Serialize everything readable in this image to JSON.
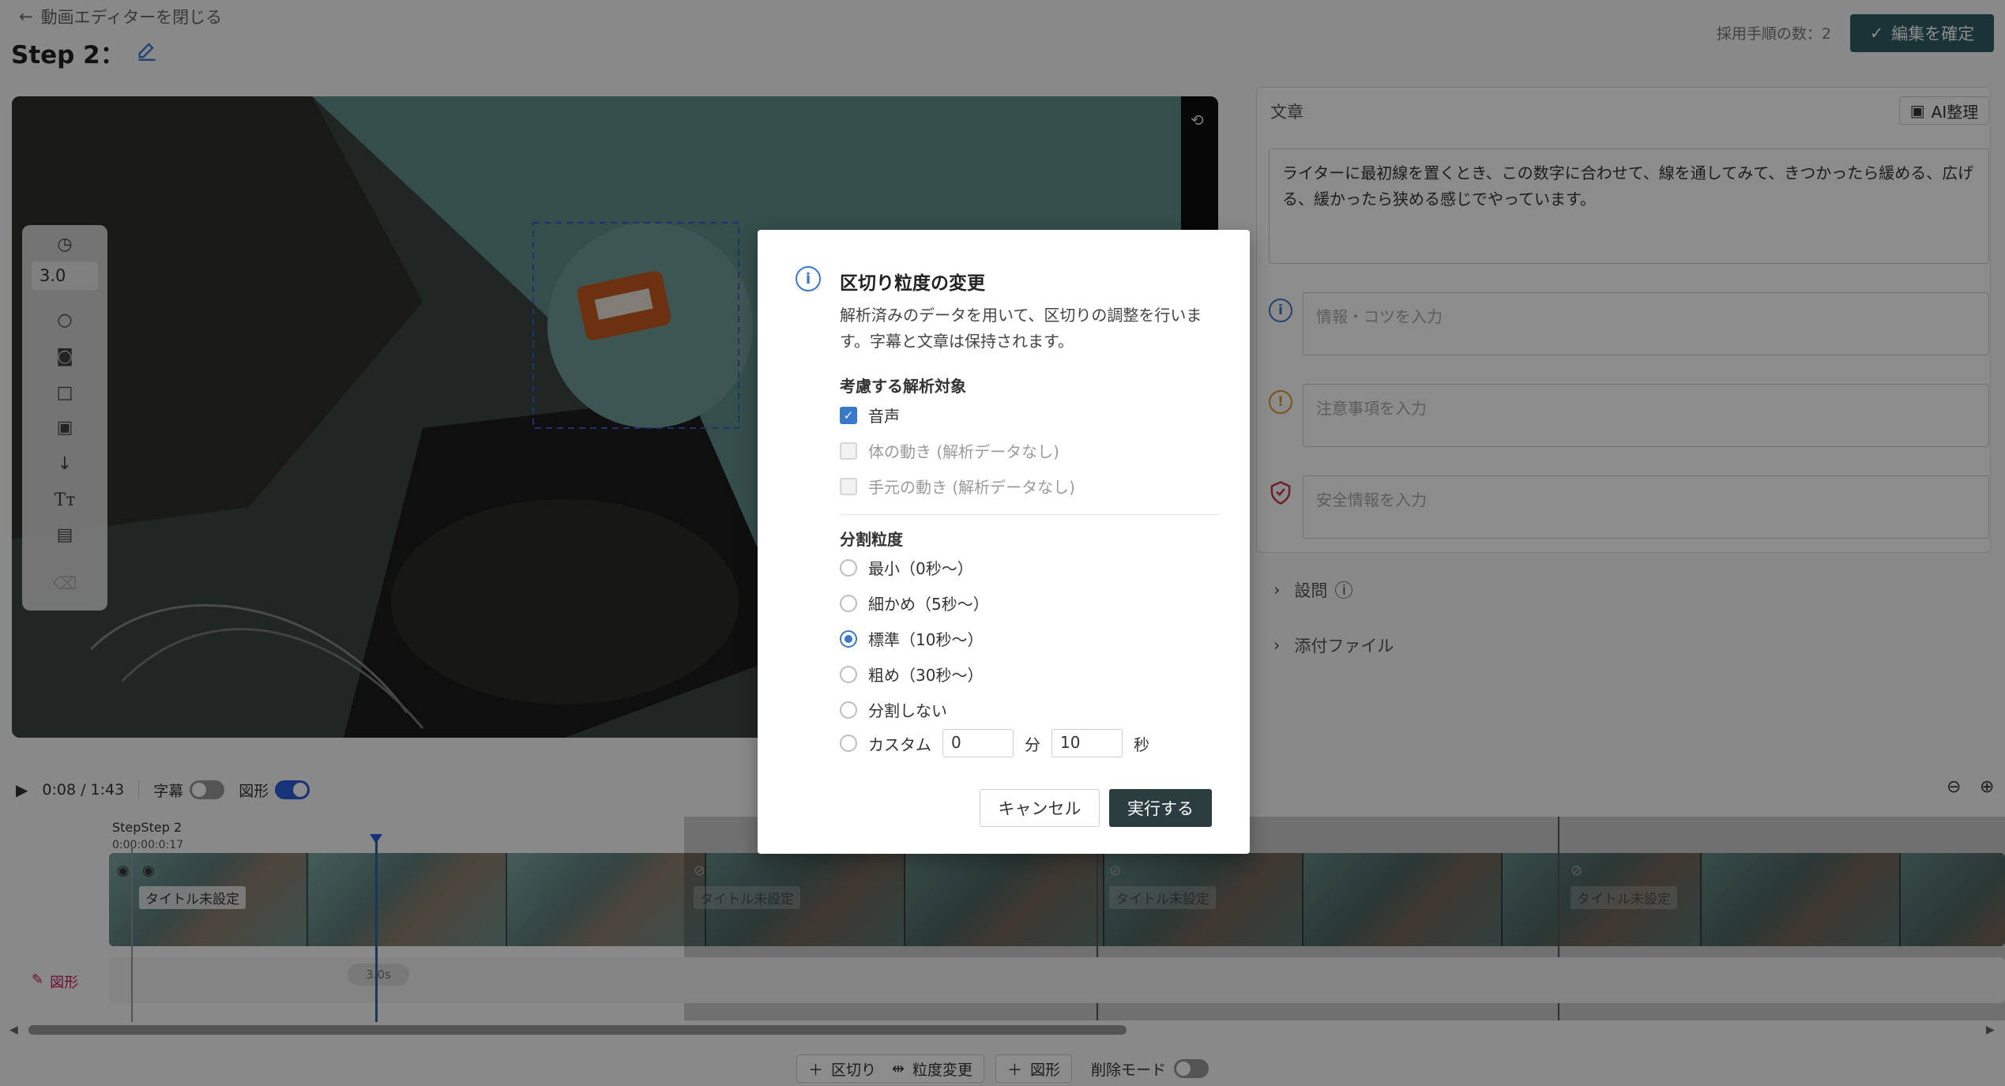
{
  "header": {
    "back_label": "動画エディターを閉じる",
    "step_title": "Step 2：",
    "step_count_label": "採用手順の数：2",
    "confirm_label": "編集を確定"
  },
  "video": {
    "duration_value": "3.0"
  },
  "panel": {
    "text_label": "文章",
    "ai_button": "AI整理",
    "main_text": "ライターに最初線を置くとき、この数字に合わせて、線を通してみて、きつかったら緩める、広げる、緩かったら狭める感じでやっています。",
    "info_placeholder": "情報・コツを入力",
    "caution_placeholder": "注意事項を入力",
    "safety_placeholder": "安全情報を入力",
    "questions_label": "設問",
    "attachments_label": "添付ファイル"
  },
  "timeline": {
    "time": "0:08 / 1:43",
    "subtitle_label": "字幕",
    "subtitle_on": false,
    "shape_label": "図形",
    "shape_on": true,
    "step_labels": "StepStep 2",
    "time_labels": "0:00:00:0:17",
    "clip_title": "タイトル未設定",
    "shape_track_label": "図形",
    "shape_badge": "3.0s"
  },
  "bottom_bar": {
    "split_label": "区切り",
    "granularity_label": "粒度変更",
    "shape_label": "図形",
    "delete_mode_label": "削除モード"
  },
  "dialog": {
    "title": "区切り粒度の変更",
    "description": "解析済みのデータを用いて、区切りの調整を行います。字幕と文章は保持されます。",
    "targets_title": "考慮する解析対象",
    "targets": [
      {
        "label": "音声",
        "checked": true,
        "disabled": false
      },
      {
        "label": "体の動き (解析データなし)",
        "checked": false,
        "disabled": true
      },
      {
        "label": "手元の動き (解析データなし)",
        "checked": false,
        "disabled": true
      }
    ],
    "granularity_title": "分割粒度",
    "options": [
      {
        "label": "最小（0秒〜）",
        "selected": false
      },
      {
        "label": "細かめ（5秒〜）",
        "selected": false
      },
      {
        "label": "標準（10秒〜）",
        "selected": true
      },
      {
        "label": "粗め（30秒〜）",
        "selected": false
      },
      {
        "label": "分割しない",
        "selected": false
      }
    ],
    "custom_label": "カスタム",
    "custom_minutes": "0",
    "minutes_unit": "分",
    "custom_seconds": "10",
    "seconds_unit": "秒",
    "cancel_label": "キャンセル",
    "run_label": "実行する"
  },
  "colors": {
    "accent": "#3a78c9",
    "confirm_button": "#2f5d65",
    "run_button": "#2b3d3f",
    "playhead": "#2a5bd7"
  }
}
